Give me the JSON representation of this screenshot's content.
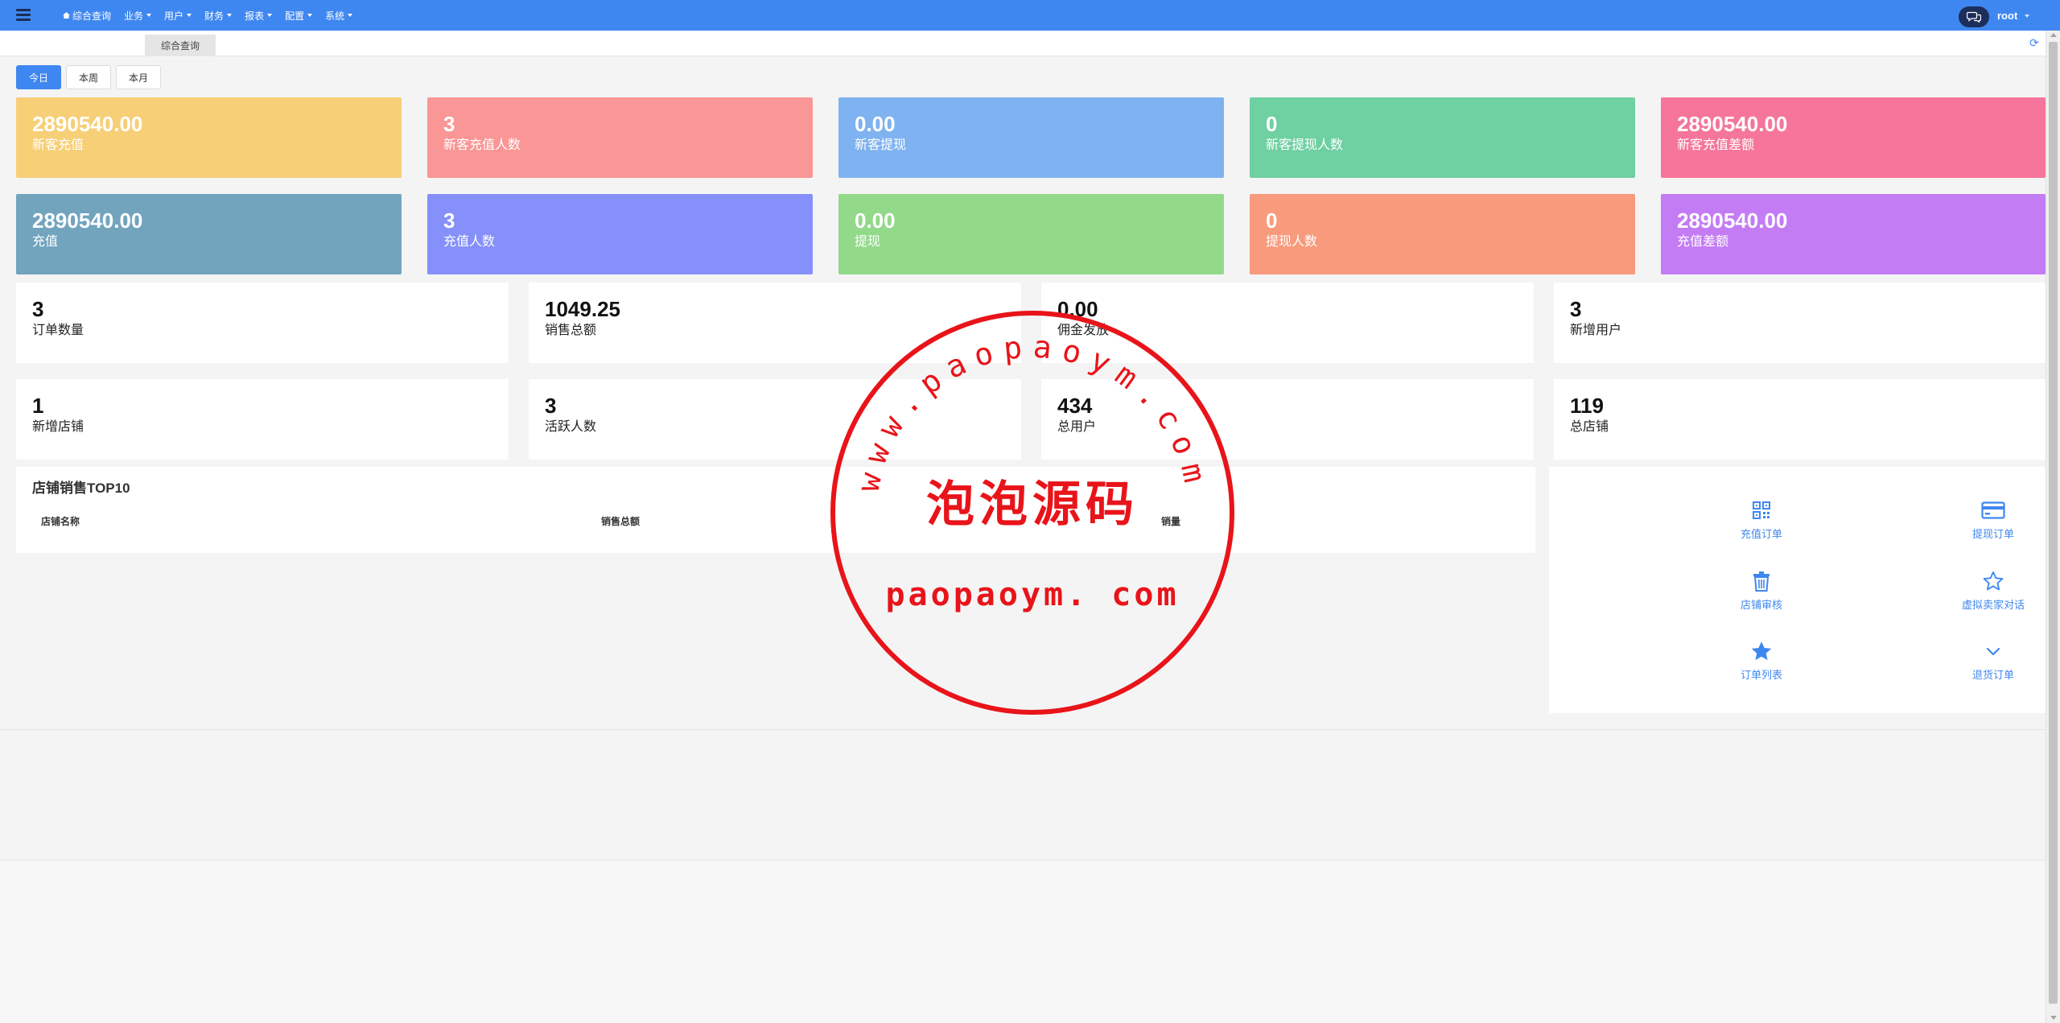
{
  "header": {
    "nav": [
      {
        "label": "综合查询",
        "has_caret": false,
        "icon": "home-icon"
      },
      {
        "label": "业务",
        "has_caret": true
      },
      {
        "label": "用户",
        "has_caret": true
      },
      {
        "label": "财务",
        "has_caret": true
      },
      {
        "label": "报表",
        "has_caret": true
      },
      {
        "label": "配置",
        "has_caret": true
      },
      {
        "label": "系统",
        "has_caret": true
      }
    ],
    "user": "root",
    "colors": {
      "bar": "#3f87f0",
      "chat_button": "#1c2e5a"
    }
  },
  "tabs": {
    "active": "综合查询"
  },
  "periods": {
    "today": "今日",
    "week": "本周",
    "month": "本月",
    "selected": "今日"
  },
  "cards_row1": [
    {
      "value": "2890540.00",
      "label": "新客充值",
      "color": "#f7cf77"
    },
    {
      "value": "3",
      "label": "新客充值人数",
      "color": "#fa9696"
    },
    {
      "value": "0.00",
      "label": "新客提现",
      "color": "#7fb2f0"
    },
    {
      "value": "0",
      "label": "新客提现人数",
      "color": "#6fd0a2"
    },
    {
      "value": "2890540.00",
      "label": "新客充值差额",
      "color": "#f6759a"
    }
  ],
  "cards_row2": [
    {
      "value": "2890540.00",
      "label": "充值",
      "color": "#72a4bd"
    },
    {
      "value": "3",
      "label": "充值人数",
      "color": "#8590fa"
    },
    {
      "value": "0.00",
      "label": "提现",
      "color": "#92d98a"
    },
    {
      "value": "0",
      "label": "提现人数",
      "color": "#f89a7c"
    },
    {
      "value": "2890540.00",
      "label": "充值差额",
      "color": "#c47cf5"
    }
  ],
  "stats_row1": [
    {
      "value": "3",
      "label": "订单数量"
    },
    {
      "value": "1049.25",
      "label": "销售总额"
    },
    {
      "value": "0.00",
      "label": "佣金发放"
    },
    {
      "value": "3",
      "label": "新增用户"
    }
  ],
  "stats_row2": [
    {
      "value": "1",
      "label": "新增店铺"
    },
    {
      "value": "3",
      "label": "活跃人数"
    },
    {
      "value": "434",
      "label": "总用户"
    },
    {
      "value": "119",
      "label": "总店铺"
    }
  ],
  "top10": {
    "title": "店铺销售TOP10",
    "columns": [
      "店铺名称",
      "销售总额",
      "销量"
    ]
  },
  "quick_links": [
    {
      "label": "充值订单",
      "icon": "qrcode-icon"
    },
    {
      "label": "提现订单",
      "icon": "credit-card-icon"
    },
    {
      "label": "店铺审核",
      "icon": "trash-icon"
    },
    {
      "label": "虚拟卖家对话",
      "icon": "star-outline-icon"
    },
    {
      "label": "订单列表",
      "icon": "star-icon"
    },
    {
      "label": "退货订单",
      "icon": "chevron-down-icon"
    }
  ],
  "watermark": {
    "arc_text": "www.paopaoym.com",
    "center_text": "泡泡源码",
    "bottom_text": "paopaoym. com",
    "color": "#e8141a"
  }
}
